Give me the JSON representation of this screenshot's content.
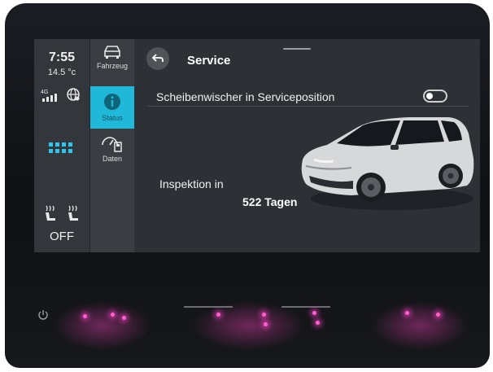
{
  "status": {
    "time": "7:55",
    "temperature": "14.5 °c",
    "network": "4G",
    "seat_heating_state": "OFF"
  },
  "nav": {
    "items": [
      {
        "id": "fahrzeug",
        "label": "Fahrzeug",
        "icon": "car-icon"
      },
      {
        "id": "status",
        "label": "Status",
        "icon": "info-icon",
        "active": true
      },
      {
        "id": "daten",
        "label": "Daten",
        "icon": "gauge-fuel-icon"
      }
    ]
  },
  "page": {
    "title": "Service",
    "back_icon": "back-arrow-icon"
  },
  "settings": {
    "wiper_label": "Scheibenwischer in Serviceposition",
    "wiper_toggle": false
  },
  "inspection": {
    "label": "Inspektion in",
    "value": "522 Tagen"
  },
  "colors": {
    "accent": "#20b8d9",
    "screen_bg": "#2d3035",
    "led": "#ff5fd0"
  }
}
